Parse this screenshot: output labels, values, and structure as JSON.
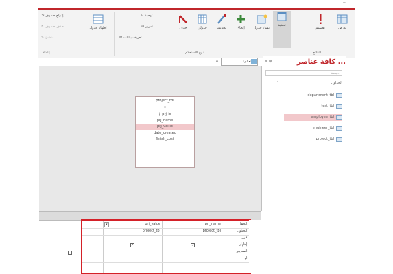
{
  "top_label": "...",
  "ribbon": {
    "view_button": "عرض",
    "create_button": "تصميم",
    "delete_button": "حذف",
    "group_results": "النتائج",
    "select_query": "تحديد",
    "make_table_query": "إنشاء جدول",
    "append_query": "إلحاق",
    "update_query": "تحديث",
    "crosstab_query": "جدولي",
    "delete_query": "حذف",
    "union_small": "توحيد",
    "passthrough_small": "تمرير",
    "ddl_small": "تعريف بيانات",
    "group_query_type": "نوع الاستعلام",
    "show_table": "إظهار جدول",
    "insert_rows_small": "إدراج صفوف",
    "delete_rows_small": "حذف صفوف",
    "builder_small": "منشئ",
    "group_setup": "إعداد"
  },
  "tab": {
    "title": "استعلام1"
  },
  "table_box": {
    "title": "project_tbl",
    "fields": [
      "*",
      "prj_id",
      "prj_name",
      "prj_value",
      "date_created",
      "finish_cost"
    ]
  },
  "nav_pane": {
    "title": "كافة عناصر ...",
    "controls": "« ⊛",
    "search_placeholder": "بحث...",
    "section": "الجداول",
    "tables": [
      "department_tbl",
      "test_tbl",
      "employee_tbl",
      "engineer_tbl",
      "project_tbl"
    ]
  },
  "grid": {
    "row_headers": [
      "الحقل:",
      "الجدول:",
      "فرز:",
      "إظهار:",
      "المعايير:",
      "أو:"
    ],
    "columns": [
      {
        "field": "prj_name",
        "table": "project_tbl",
        "show": true
      },
      {
        "field": "prj_value",
        "table": "project_tbl",
        "show": true
      },
      {
        "field": "",
        "table": "",
        "show": false
      }
    ],
    "dropdown_glyph": "▾",
    "check_glyph": "✓"
  }
}
